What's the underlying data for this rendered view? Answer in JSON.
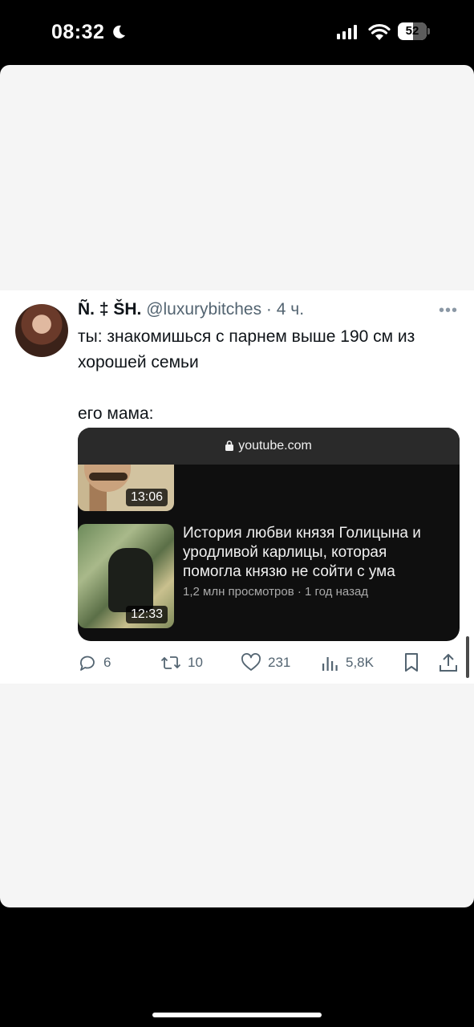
{
  "status_bar": {
    "time": "08:32",
    "battery": "52",
    "icons": [
      "moon-icon",
      "cellular-signal-icon",
      "wifi-icon",
      "battery-icon"
    ]
  },
  "tweet": {
    "author_name": "Ñ. ‡ ŠH.",
    "author_handle": "@luxurybitches",
    "separator": "·",
    "age": "4 ч.",
    "text_line1": "ты: знакомишься с парнем выше 190 см из хорошей семьи",
    "text_line2": "его мама:",
    "media": {
      "url": "youtube.com",
      "video1_duration": "13:06",
      "video2_duration": "12:33",
      "video2_title": "История любви князя Голицына и уродливой карлицы, которая помогла князю не сойти с ума",
      "video2_meta": "1,2 млн просмотров · 1 год назад"
    },
    "actions": {
      "replies": "6",
      "retweets": "10",
      "likes": "231",
      "views": "5,8K"
    }
  },
  "colors": {
    "background": "#000000",
    "sheet": "#f5f5f5",
    "card": "#ffffff",
    "text_primary": "#0f1419",
    "text_secondary": "#536471",
    "media_background": "#0f0f0f"
  }
}
